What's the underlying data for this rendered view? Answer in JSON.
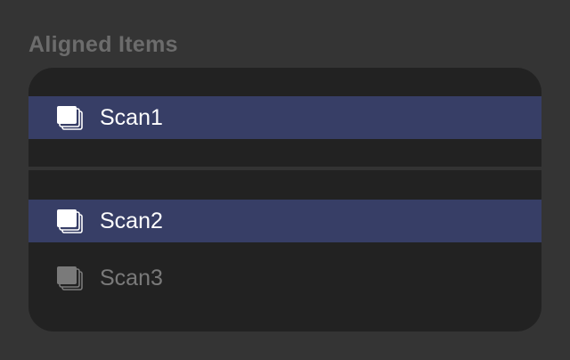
{
  "section": {
    "title": "Aligned Items"
  },
  "items": [
    {
      "label": "Scan1",
      "selected": true,
      "enabled": true,
      "icon": "layers-icon"
    },
    {
      "label": "Scan2",
      "selected": true,
      "enabled": true,
      "icon": "layers-icon"
    },
    {
      "label": "Scan3",
      "selected": false,
      "enabled": false,
      "icon": "layers-icon"
    }
  ],
  "colors": {
    "background": "#343434",
    "list_background": "#222222",
    "selection": "#373e66",
    "text": "#ffffff",
    "text_disabled": "#7a7a7a",
    "title": "#6c6c6c"
  }
}
